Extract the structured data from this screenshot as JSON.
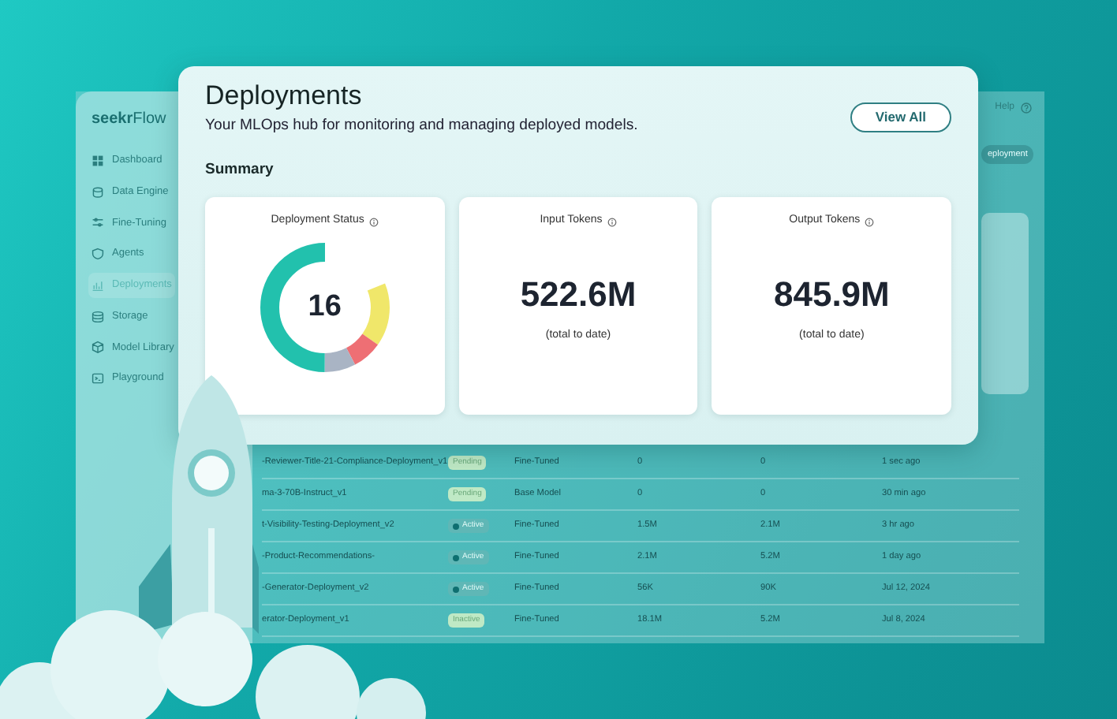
{
  "background_app": {
    "logo": "**seekr**Flow",
    "sidebar": {
      "items": [
        {
          "label": "Dashboard",
          "selected": false
        },
        {
          "label": "Data Engine",
          "selected": false
        },
        {
          "label": "Fine-Tuning",
          "selected": false
        },
        {
          "label": "Agents",
          "selected": false
        },
        {
          "label": "Deployments",
          "selected": true
        },
        {
          "label": "Storage",
          "selected": false
        },
        {
          "label": "Model Library",
          "selected": false
        },
        {
          "label": "Playground",
          "selected": false
        }
      ]
    },
    "top_bar": {
      "help": "Help"
    },
    "deploy_button": "eployment",
    "table": {
      "rows": [
        {
          "name": "-Reviewer-Title-21-Compliance-Deployment_v1",
          "status": {
            "kind": "pending",
            "label": "Pending"
          },
          "type": "Fine-Tuned",
          "input": "0",
          "output": "0",
          "updated": "1 sec ago"
        },
        {
          "name": "ma-3-70B-Instruct_v1",
          "status": {
            "kind": "pending",
            "label": "Pending"
          },
          "type": "Base Model",
          "input": "0",
          "output": "0",
          "updated": "30 min ago"
        },
        {
          "name": "t-Visibility-Testing-Deployment_v2",
          "status": {
            "kind": "active",
            "label": "Active"
          },
          "type": "Fine-Tuned",
          "input": "1.5M",
          "output": "2.1M",
          "updated": "3 hr ago"
        },
        {
          "name": "-Product-Recommendations-",
          "status": {
            "kind": "active",
            "label": "Active"
          },
          "type": "Fine-Tuned",
          "input": "2.1M",
          "output": "5.2M",
          "updated": "1 day ago"
        },
        {
          "name": "-Generator-Deployment_v2",
          "status": {
            "kind": "active",
            "label": "Active"
          },
          "type": "Fine-Tuned",
          "input": "56K",
          "output": "90K",
          "updated": "Jul 12, 2024"
        },
        {
          "name": "erator-Deployment_v1",
          "status": {
            "kind": "pending",
            "label": "Inactive"
          },
          "type": "Fine-Tuned",
          "input": "18.1M",
          "output": "5.2M",
          "updated": "Jul 8, 2024"
        }
      ]
    }
  },
  "front_card": {
    "title": "Deployments",
    "subtitle": "Your MLOps hub for monitoring and managing deployed models.",
    "view_all_button": "View All",
    "section_title": "Summary",
    "metrics": [
      {
        "kind": "donut",
        "title": "Deployment Status",
        "value": "16"
      },
      {
        "kind": "number",
        "title": "Input Tokens",
        "value": "522.6M",
        "caption": "(total to date)"
      },
      {
        "kind": "number",
        "title": "Output Tokens",
        "value": "845.9M",
        "caption": "(total to date)"
      }
    ]
  }
}
